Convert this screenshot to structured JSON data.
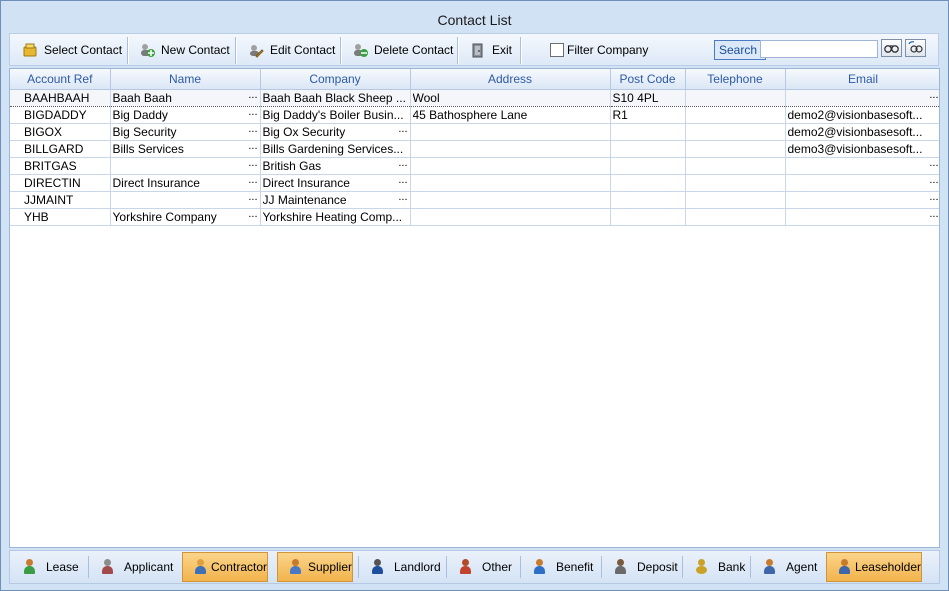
{
  "window": {
    "title": "Contact List"
  },
  "toolbar": {
    "select_label": "Select Contact",
    "new_label": "New Contact",
    "edit_label": "Edit Contact",
    "delete_label": "Delete Contact",
    "exit_label": "Exit",
    "filter_label": "Filter Company",
    "search_label": "Search",
    "search_value": ""
  },
  "table": {
    "columns": [
      "Account Ref",
      "Name",
      "Company",
      "Address",
      "Post Code",
      "Telephone",
      "Email"
    ],
    "rows": [
      [
        "BAAHBAAH",
        "Baah Baah",
        "Baah Baah Black Sheep ...",
        "Wool",
        "S10 4PL",
        "",
        ""
      ],
      [
        "BIGDADDY",
        "Big Daddy",
        "Big Daddy's Boiler Busin...",
        "45  Bathosphere Lane",
        "R1",
        "",
        "demo2@visionbasesoft..."
      ],
      [
        "BIGOX",
        "Big Security",
        "Big Ox Security",
        "",
        "",
        "",
        "demo2@visionbasesoft..."
      ],
      [
        "BILLGARD",
        "Bills Services",
        "Bills Gardening Services...",
        "",
        "",
        "",
        "demo3@visionbasesoft..."
      ],
      [
        "BRITGAS",
        "",
        "British Gas",
        "",
        "",
        "",
        ""
      ],
      [
        "DIRECTIN",
        "Direct Insurance",
        "Direct Insurance",
        "",
        "",
        "",
        ""
      ],
      [
        "JJMAINT",
        "",
        "JJ Maintenance",
        "",
        "",
        "",
        ""
      ],
      [
        "YHB",
        "Yorkshire Company",
        "Yorkshire Heating Comp...",
        "",
        "",
        "",
        ""
      ]
    ]
  },
  "tabs": [
    {
      "label": "Lease",
      "active": false
    },
    {
      "label": "Applicant",
      "active": false
    },
    {
      "label": "Contractor",
      "active": true
    },
    {
      "label": "Supplier",
      "active": true
    },
    {
      "label": "Landlord",
      "active": false
    },
    {
      "label": "Other",
      "active": false
    },
    {
      "label": "Benefit",
      "active": false
    },
    {
      "label": "Deposit",
      "active": false
    },
    {
      "label": "Bank",
      "active": false
    },
    {
      "label": "Agent",
      "active": false
    },
    {
      "label": "Leaseholder",
      "active": true
    }
  ],
  "colors": {
    "header_text": "#2e5aa5",
    "active_tab": "#f2b34c",
    "window_bg": "#d2e2f5"
  }
}
